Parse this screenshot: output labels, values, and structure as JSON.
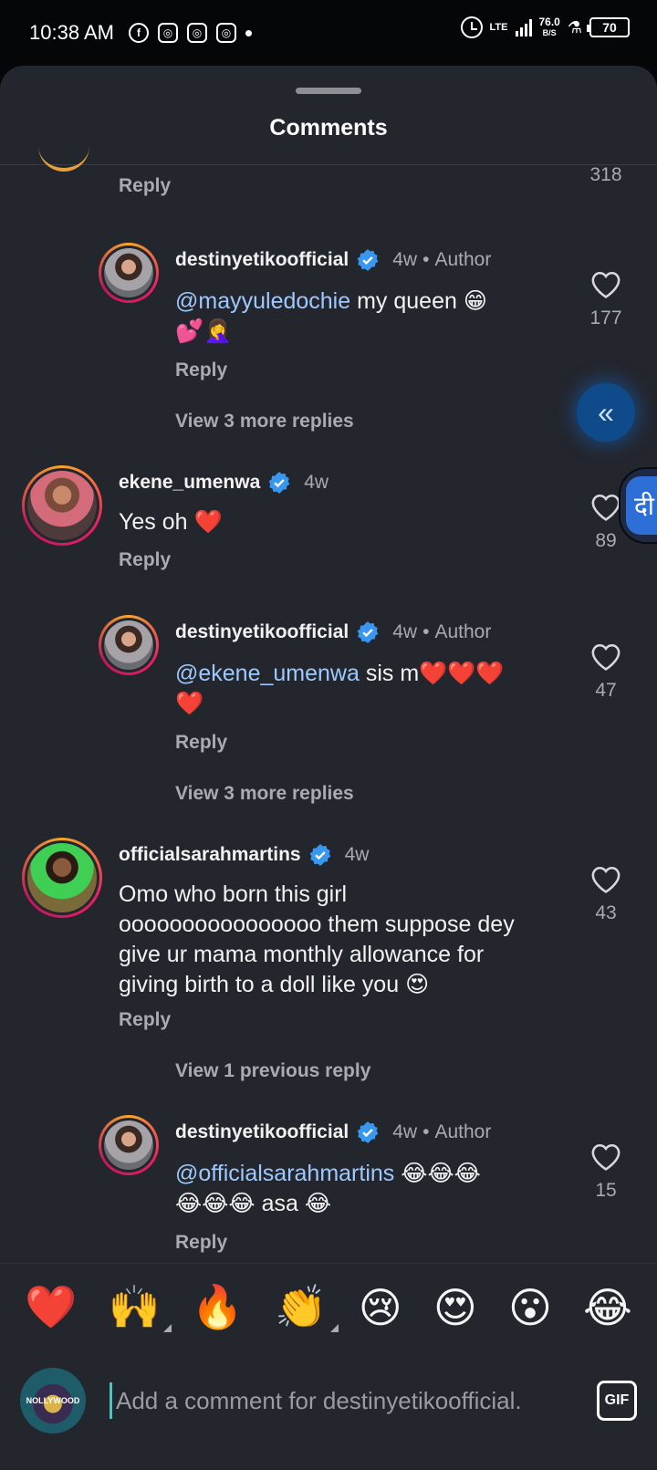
{
  "status_bar": {
    "time": "10:38 AM",
    "notification_icons": [
      "facebook-icon",
      "instagram-icon",
      "instagram-icon",
      "instagram-icon"
    ],
    "network": "LTE",
    "speed_value": "76.0",
    "speed_unit": "B/S",
    "battery": "70"
  },
  "sheet": {
    "title": "Comments"
  },
  "top_partial": {
    "reply": "Reply",
    "likes": "318"
  },
  "comments": [
    {
      "username": "destinyetikoofficial",
      "age": "4w",
      "badge": "Author",
      "mention": "@mayyuledochie",
      "text_line1": " my queen 😁",
      "text_line2": "💕🤦‍♀️",
      "reply": "Reply",
      "likes": "177",
      "view_more": "View 3 more replies"
    },
    {
      "username": "ekene_umenwa",
      "age": "4w",
      "text": "Yes oh ❤️",
      "reply": "Reply",
      "likes": "89"
    },
    {
      "username": "destinyetikoofficial",
      "age": "4w",
      "badge": "Author",
      "mention": "@ekene_umenwa",
      "text_line1": " sis m❤️❤️❤️",
      "text_line2": "❤️",
      "reply": "Reply",
      "likes": "47",
      "view_more": "View 3 more replies"
    },
    {
      "username": "officialsarahmartins",
      "age": "4w",
      "text_lines": [
        "Omo who born this girl",
        "oooooooooooooooo them suppose dey",
        "give ur mama monthly allowance for",
        "giving birth to a doll like you 😍"
      ],
      "reply": "Reply",
      "likes": "43",
      "view_previous": "View 1 previous reply"
    },
    {
      "username": "destinyetikoofficial",
      "age": "4w",
      "badge": "Author",
      "mention": "@officialsarahmartins",
      "text_line1": " 😂😂😂",
      "text_line2": "😂😂😂 asa 😂",
      "reply": "Reply",
      "likes": "15"
    }
  ],
  "emoji_bar": [
    "❤️",
    "🙌",
    "🔥",
    "👏",
    "😢",
    "😍",
    "😮",
    "😂"
  ],
  "input": {
    "placeholder": "Add a comment for destinyetikoofficial.",
    "gif_label": "GIF",
    "avatar_text": "NOLLYWOOD"
  },
  "side_tab_label": "दी",
  "float_button_glyph": "«"
}
